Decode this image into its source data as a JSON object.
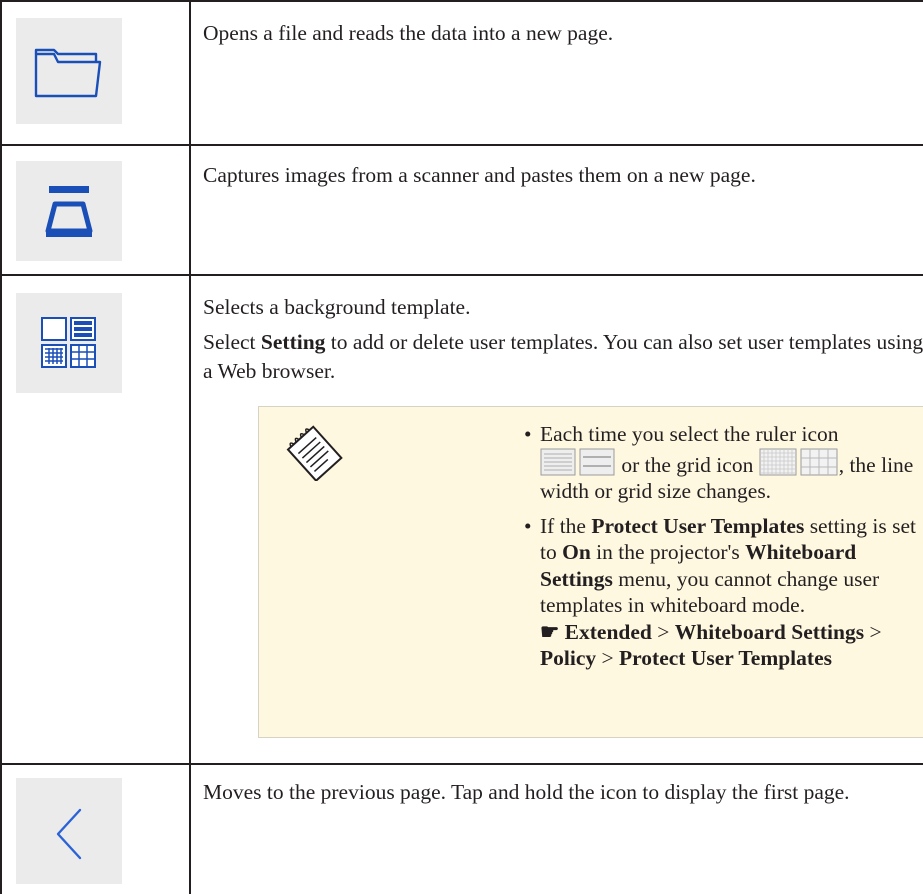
{
  "rows": [
    {
      "icon": "folder-icon",
      "text": "Opens a file and reads the data into a new page."
    },
    {
      "icon": "scanner-icon",
      "text": "Captures images from a scanner and pastes them on a new page."
    },
    {
      "icon": "template-icon",
      "line1": "Selects a background template.",
      "line2_pre": "Select ",
      "line2_bold": "Setting",
      "line2_post": " to add or delete user templates. You can also set user templates using a Web browser.",
      "note": {
        "icon": "notepad-icon",
        "bullet1_pre": "Each time you select the ruler icon",
        "bullet1_mid": " or the grid icon ",
        "bullet1_post": ", the line width or grid size changes.",
        "bullet2_a": "If the ",
        "bullet2_b": "Protect User Templates",
        "bullet2_c": " setting is set to ",
        "bullet2_d": "On",
        "bullet2_e": " in the projector's ",
        "bullet2_f": "Whiteboard Settings",
        "bullet2_g": " menu, you cannot change user templates in whiteboard mode.",
        "path_symbol": "☛",
        "path_1": "Extended",
        "path_sep": ">",
        "path_2": "Whiteboard Settings",
        "path_3": "Policy",
        "path_4": "Protect User Templates"
      }
    },
    {
      "icon": "previous-page-icon",
      "text": "Moves to the previous page. Tap and hold the icon to display the first page."
    }
  ],
  "colors": {
    "icon_blue": "#1a4fb8",
    "icon_box_bg": "#ebebeb",
    "note_bg": "#fef8e1"
  }
}
